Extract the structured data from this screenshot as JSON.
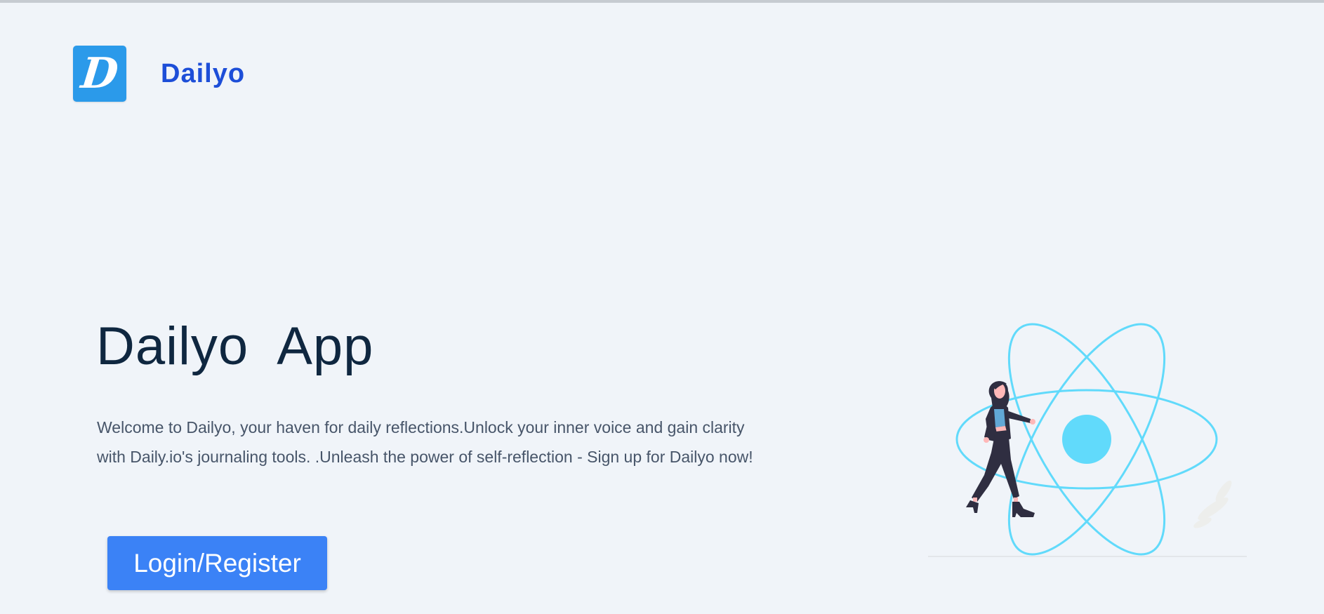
{
  "header": {
    "logo_letter": "D",
    "brand": "Dailyo"
  },
  "hero": {
    "title": "Dailyo  App",
    "description": "Welcome to Dailyo, your haven for daily reflections.Unlock your inner voice and gain clarity with Daily.io's journaling tools. .Unleash the power of self-reflection - Sign up for Dailyo now!",
    "cta_label": "Login/Register"
  },
  "colors": {
    "background": "#f0f4f9",
    "brand": "#1d4ed8",
    "logo": "#2b9aea",
    "button": "#3b82f6",
    "title": "#0f2740",
    "atom": "#61dafb",
    "figure": "#2f2e41"
  },
  "illustration": {
    "icon": "react-atom-woman-walking-illustration"
  }
}
